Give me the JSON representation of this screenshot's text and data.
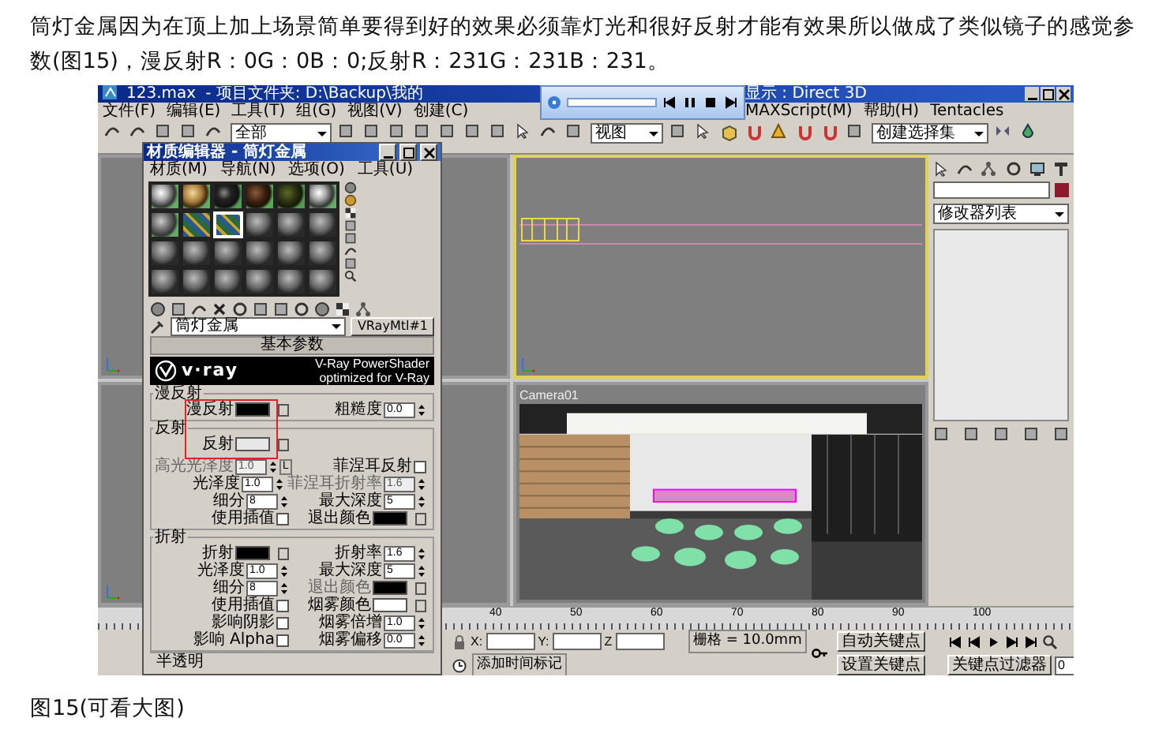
{
  "article": {
    "paragraph": "筒灯金属因为在顶上加上场景简单要得到好的效果必须靠灯光和很好反射才能有效果所以做成了类似镜子的感觉参数(图15)，漫反射R：0G：0B：0;反射R：231G：231B：231。",
    "caption": "图15(可看大图)"
  },
  "app": {
    "title": "123.max",
    "project": "- 项目文件夹: D:\\Backup\\我的",
    "renderer": "显示 : Direct 3D",
    "menus": [
      "文件(F)",
      "编辑(E)",
      "工具(T)",
      "组(G)",
      "视图(V)",
      "创建(C)"
    ],
    "menus_after_player": [
      "MAXScript(M)",
      "帮助(H)",
      "Tentacles"
    ],
    "toolbar_dropdowns": [
      "全部",
      "视图",
      "创建选择集"
    ],
    "viewports": [
      {
        "kind": "empty",
        "active": false
      },
      {
        "kind": "top",
        "active": true
      },
      {
        "kind": "front",
        "active": false
      },
      {
        "kind": "camera",
        "label": "Camera01",
        "active": false
      }
    ],
    "command_panel": {
      "modifier_list": "修改器列表"
    },
    "timeline_ticks": [
      "40",
      "50",
      "60",
      "70",
      "80",
      "90",
      "100"
    ],
    "status": {
      "x_label": "X:",
      "y_label": "Y:",
      "z_label": "Z",
      "grid": "栅格 = 10.0mm",
      "time_tag": "添加时间标记",
      "auto_key": "自动关键点",
      "set_key": "设置关键点",
      "key_filter": "关键点过滤器",
      "frame": "0"
    }
  },
  "material_editor": {
    "title": "材质编辑器 - 筒灯金属",
    "menus": [
      "材质(M)",
      "导航(N)",
      "选项(O)",
      "工具(U)"
    ],
    "slots": [
      {
        "kind": "chrome",
        "selected": false
      },
      {
        "kind": "gold",
        "selected": false
      },
      {
        "kind": "black",
        "selected": false
      },
      {
        "kind": "brown",
        "selected": false
      },
      {
        "kind": "olive",
        "selected": false
      },
      {
        "kind": "chrome",
        "selected": false
      },
      {
        "kind": "steel",
        "selected": false
      },
      {
        "kind": "pattern",
        "selected": false
      },
      {
        "kind": "pattern",
        "selected": true
      },
      {
        "kind": "blank",
        "selected": false
      },
      {
        "kind": "blank",
        "selected": false
      },
      {
        "kind": "blank",
        "selected": false
      },
      {
        "kind": "blank",
        "selected": false
      },
      {
        "kind": "blank",
        "selected": false
      },
      {
        "kind": "blank",
        "selected": false
      },
      {
        "kind": "blank",
        "selected": false
      },
      {
        "kind": "blank",
        "selected": false
      },
      {
        "kind": "blank",
        "selected": false
      },
      {
        "kind": "blank",
        "selected": false
      },
      {
        "kind": "blank",
        "selected": false
      },
      {
        "kind": "blank",
        "selected": false
      },
      {
        "kind": "blank",
        "selected": false
      },
      {
        "kind": "blank",
        "selected": false
      },
      {
        "kind": "blank",
        "selected": false
      }
    ],
    "material_name": "筒灯金属",
    "material_type": "VRayMtl#1",
    "rollout": "基本参数",
    "banner": {
      "logo": "v·ray",
      "line_1": "V-Ray PowerShader",
      "line_2": "optimized for V-Ray"
    },
    "highlight": true,
    "groups": [
      {
        "title": "漫反射",
        "rows": [
          [
            {
              "label": "漫反射",
              "kind": "swatch",
              "color": "#000000",
              "disabled": false
            },
            {
              "label": "粗糙度",
              "kind": "spinner",
              "value": "0.0",
              "disabled": false
            }
          ]
        ]
      },
      {
        "title": "反射",
        "rows": [
          [
            {
              "label": "反射",
              "kind": "swatch",
              "color": "#e7e7e7",
              "disabled": false
            }
          ],
          [
            {
              "label": "高光光泽度",
              "kind": "spinner",
              "value": "1.0",
              "disabled": true,
              "lock": "L"
            },
            {
              "label": "菲涅耳反射",
              "kind": "checkbox",
              "checked": false,
              "disabled": false
            }
          ],
          [
            {
              "label": "光泽度",
              "kind": "spinner",
              "value": "1.0",
              "disabled": false
            },
            {
              "label": "菲涅耳折射率",
              "kind": "spinner",
              "value": "1.6",
              "disabled": true
            }
          ],
          [
            {
              "label": "细分",
              "kind": "spinner",
              "value": "8",
              "disabled": false
            },
            {
              "label": "最大深度",
              "kind": "spinner",
              "value": "5",
              "disabled": false
            }
          ],
          [
            {
              "label": "使用插值",
              "kind": "checkbox",
              "checked": false,
              "disabled": false
            },
            {
              "label": "退出颜色",
              "kind": "swatch",
              "color": "#000000",
              "disabled": false
            }
          ]
        ]
      },
      {
        "title": "折射",
        "rows": [
          [
            {
              "label": "折射",
              "kind": "swatch",
              "color": "#000000",
              "disabled": false
            },
            {
              "label": "折射率",
              "kind": "spinner",
              "value": "1.6",
              "disabled": false
            }
          ],
          [
            {
              "label": "光泽度",
              "kind": "spinner",
              "value": "1.0",
              "disabled": false
            },
            {
              "label": "最大深度",
              "kind": "spinner",
              "value": "5",
              "disabled": false
            }
          ],
          [
            {
              "label": "细分",
              "kind": "spinner",
              "value": "8",
              "disabled": false
            },
            {
              "label": "退出颜色",
              "kind": "swatch",
              "color": "#000000",
              "disabled": true
            }
          ],
          [
            {
              "label": "使用插值",
              "kind": "checkbox",
              "checked": false,
              "disabled": false
            },
            {
              "label": "烟雾颜色",
              "kind": "swatch",
              "color": "#ffffff",
              "disabled": false
            }
          ],
          [
            {
              "label": "影响阴影",
              "kind": "checkbox",
              "checked": false,
              "disabled": false
            },
            {
              "label": "烟雾倍增",
              "kind": "spinner",
              "value": "1.0",
              "disabled": false
            }
          ],
          [
            {
              "label": "影响 Alpha",
              "kind": "checkbox",
              "checked": false,
              "disabled": false
            },
            {
              "label": "烟雾偏移",
              "kind": "spinner",
              "value": "0.0",
              "disabled": false
            }
          ]
        ]
      }
    ],
    "next_rollout": "半透明"
  }
}
